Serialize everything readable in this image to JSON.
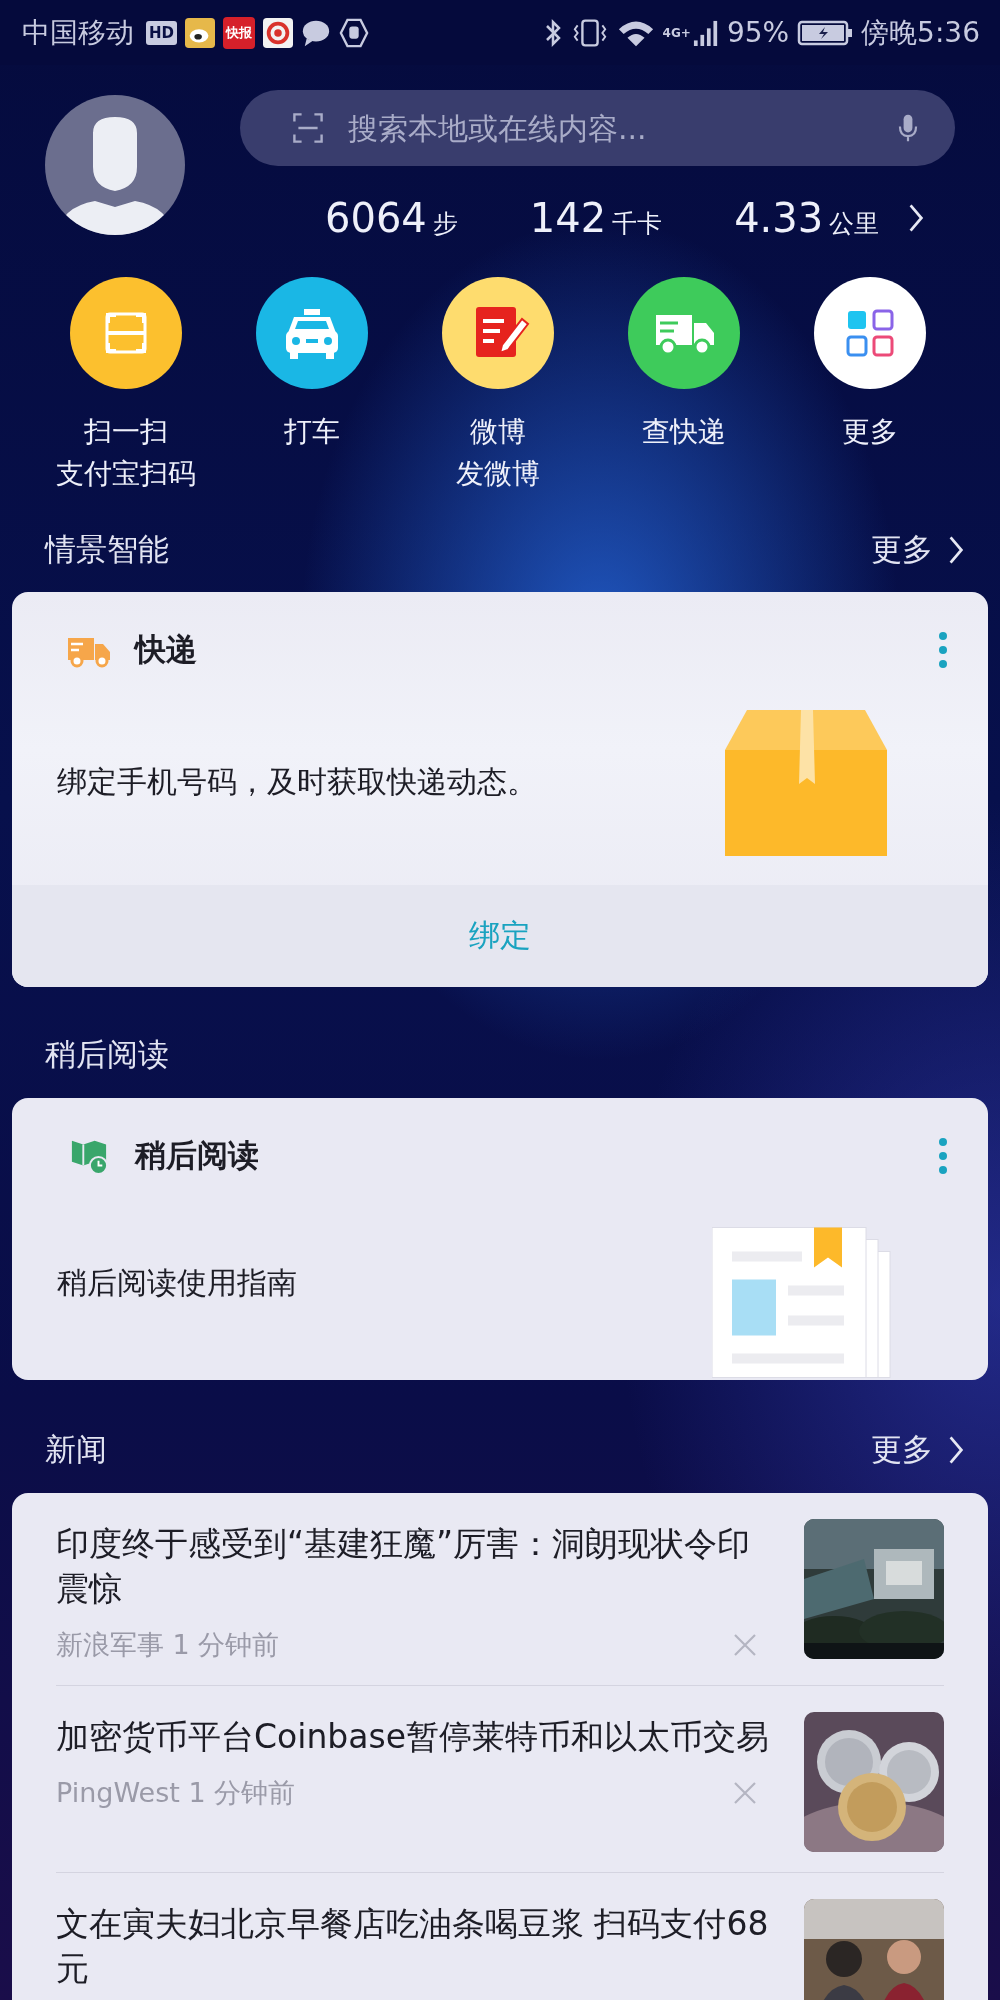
{
  "status_bar": {
    "carrier": "中国移动",
    "notifications": [
      {
        "kind": "hd",
        "label": "HD"
      },
      {
        "kind": "weibo"
      },
      {
        "kind": "kuaibao",
        "label": "快报"
      },
      {
        "kind": "swirl"
      },
      {
        "kind": "chat"
      },
      {
        "kind": "hand"
      }
    ],
    "network": "4G+",
    "battery": "95%",
    "time": "傍晚5:36"
  },
  "search": {
    "placeholder": "搜索本地或在线内容..."
  },
  "stats": [
    {
      "value": "6064",
      "unit": "步"
    },
    {
      "value": "142",
      "unit": "千卡"
    },
    {
      "value": "4.33",
      "unit": "公里"
    }
  ],
  "shortcuts": [
    {
      "kind": "scan",
      "label": "扫一扫",
      "sublabel": "支付宝扫码"
    },
    {
      "kind": "taxi",
      "label": "打车"
    },
    {
      "kind": "note",
      "label": "微博",
      "sublabel": "发微博"
    },
    {
      "kind": "truck",
      "label": "查快递"
    },
    {
      "kind": "more",
      "label": "更多"
    }
  ],
  "smart": {
    "title": "情景智能",
    "more": "更多",
    "card": {
      "title": "快递",
      "text": "绑定手机号码，及时获取快递动态。",
      "action": "绑定"
    }
  },
  "read_later": {
    "title": "稍后阅读",
    "card": {
      "title": "稍后阅读",
      "text": "稍后阅读使用指南"
    }
  },
  "news": {
    "title": "新闻",
    "more": "更多",
    "items": [
      {
        "title": "印度终于感受到“基建狂魔”厉害：洞朗现状令印震惊",
        "meta": "新浪军事 1 分钟前",
        "kind": "picture"
      },
      {
        "title": "加密货币平台Coinbase暂停莱特币和以太币交易",
        "meta": "PingWest 1 分钟前",
        "kind": "picture"
      },
      {
        "title": "文在寅夫妇北京早餐店吃油条喝豆浆 扫码支付68元",
        "kind": "picture"
      }
    ]
  }
}
